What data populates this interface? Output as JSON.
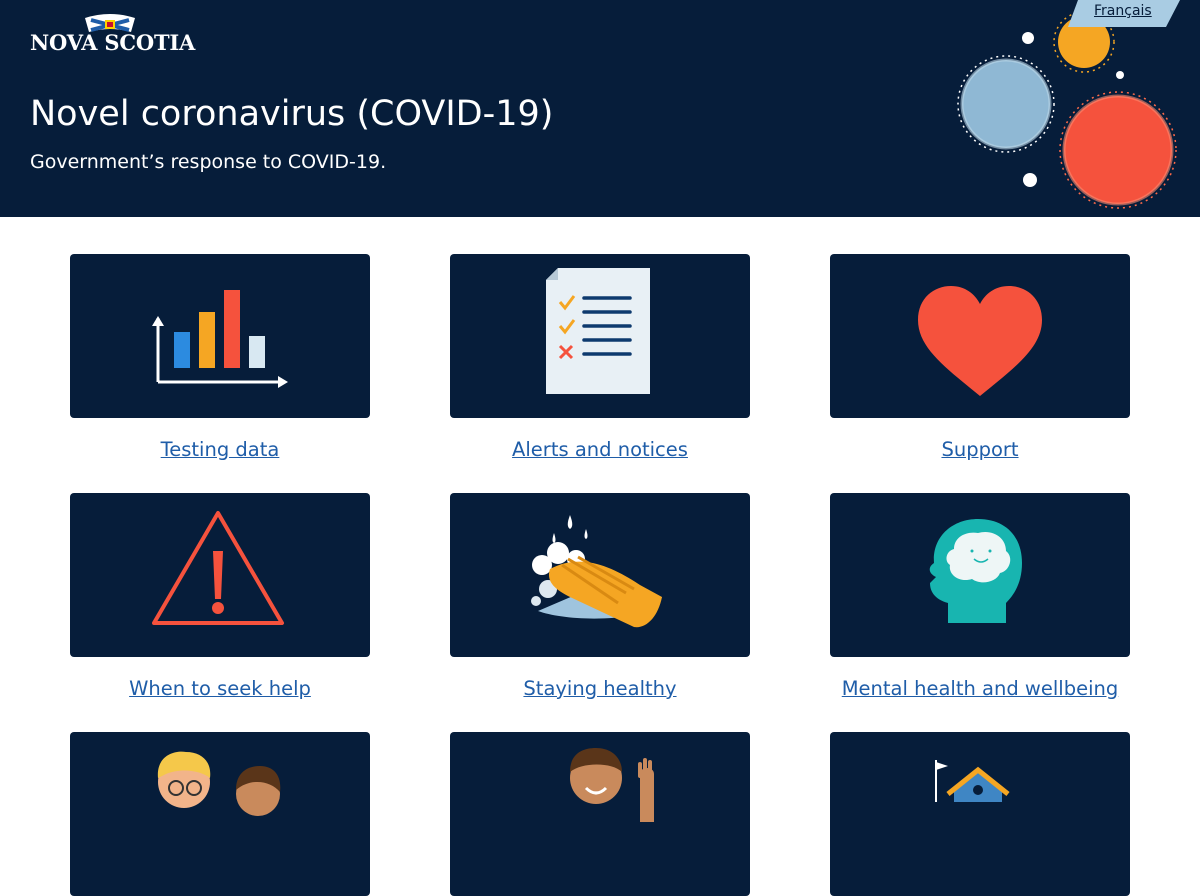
{
  "header": {
    "logo_text": "NOVA SCOTIA",
    "language_link": "Français",
    "title": "Novel coronavirus (COVID-19)",
    "subtitle": "Government’s response to COVID-19.",
    "colors": {
      "background": "#061d3a",
      "language_tab": "#a9cce3"
    }
  },
  "cards": [
    {
      "label": "Testing data",
      "icon": "bar-chart-icon"
    },
    {
      "label": "Alerts and notices",
      "icon": "checklist-icon"
    },
    {
      "label": "Support",
      "icon": "heart-icon"
    },
    {
      "label": "When to seek help",
      "icon": "warning-icon"
    },
    {
      "label": "Staying healthy",
      "icon": "handwashing-icon"
    },
    {
      "label": "Mental health and wellbeing",
      "icon": "brain-head-icon"
    },
    {
      "label": "",
      "icon": "people-icon"
    },
    {
      "label": "",
      "icon": "waving-person-icon"
    },
    {
      "label": "",
      "icon": "house-icon"
    }
  ],
  "colors": {
    "card_background": "#061d3a",
    "link": "#1f5da8"
  }
}
